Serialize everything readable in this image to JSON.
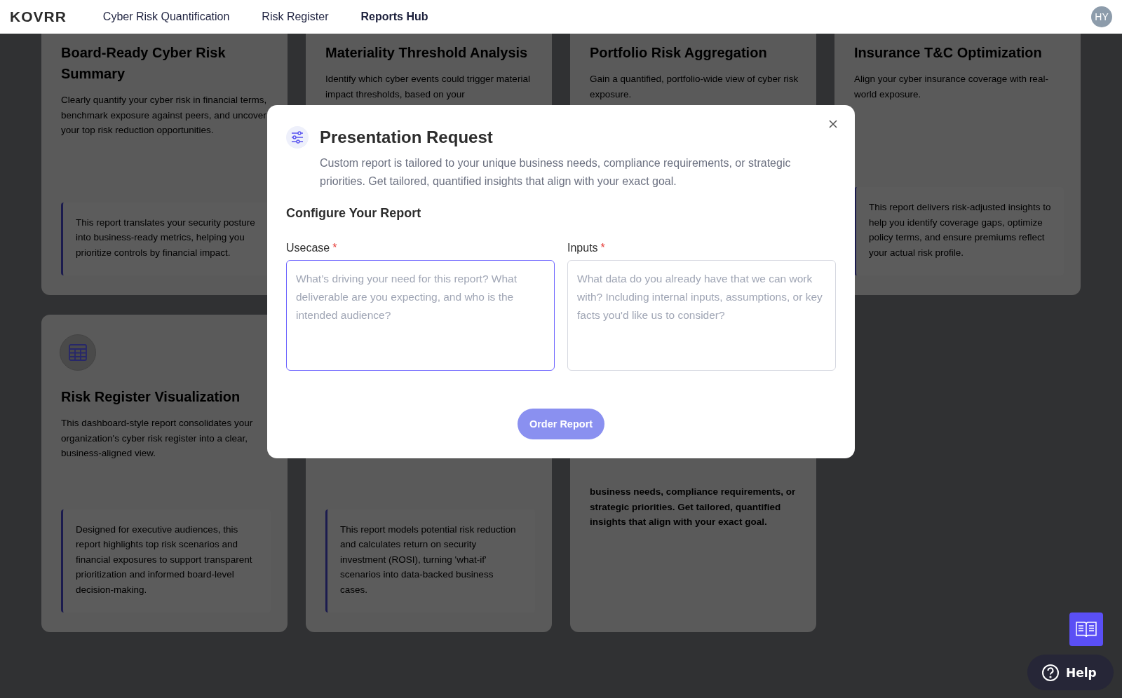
{
  "header": {
    "logo": "KOVRR",
    "nav": [
      {
        "label": "Cyber Risk Quantification",
        "selected": false
      },
      {
        "label": "Risk Register",
        "selected": false
      },
      {
        "label": "Reports Hub",
        "selected": true
      }
    ],
    "avatar": "HY"
  },
  "cards": [
    {
      "title": "Board-Ready Cyber Risk Summary",
      "description": "Clearly quantify your cyber risk in financial terms, benchmark exposure against peers, and uncover your top risk reduction opportunities.",
      "quote": "This report translates your security posture into business-ready metrics, helping you prioritize controls by financial impact."
    },
    {
      "title": "Materiality Threshold Analysis",
      "description": "Identify which cyber events could trigger material impact thresholds, based on your"
    },
    {
      "title": "Portfolio Risk Aggregation",
      "description": "Gain a quantified, portfolio-wide view of cyber risk exposure."
    },
    {
      "title": "Insurance T&C Optimization",
      "description": "Align your cyber insurance coverage with real-world exposure.",
      "quote": "This report delivers risk-adjusted insights to help you identify coverage gaps, optimize policy terms, and ensure premiums reflect your actual risk profile."
    },
    {
      "icon": true,
      "title": "Risk Register Visualization",
      "description": "This dashboard-style report consolidates your organization's cyber risk register into a clear, business-aligned view.",
      "quote": "Designed for executive audiences, this report highlights top risk scenarios and financial exposures to support transparent prioritization and informed board-level decision-making."
    },
    {
      "quote": "This report models potential risk reduction and calculates return on security investment (ROSI), turning 'what-if' scenarios into data-backed business cases."
    },
    {
      "highlight": "business needs, compliance requirements, or strategic priorities. Get tailored, quantified insights that align with your exact goal."
    }
  ],
  "modal": {
    "title": "Presentation Request",
    "description": "Custom report is tailored to your unique business needs, compliance requirements, or strategic priorities. Get tailored, quantified insights that align with your exact goal.",
    "section": "Configure Your Report",
    "fields": [
      {
        "label": "Usecase",
        "required_mark": "*",
        "placeholder": "What’s driving your need for this report? What deliverable are you expecting, and who is the intended audience?",
        "focused": true
      },
      {
        "label": "Inputs",
        "required_mark": "*",
        "placeholder": "What data do you already have that we can work with? Including internal inputs, assumptions, or key facts you'd like us to consider?",
        "focused": false
      }
    ],
    "button": {
      "label": "Order Report",
      "disabled": true
    }
  },
  "help": {
    "label": "Help"
  }
}
